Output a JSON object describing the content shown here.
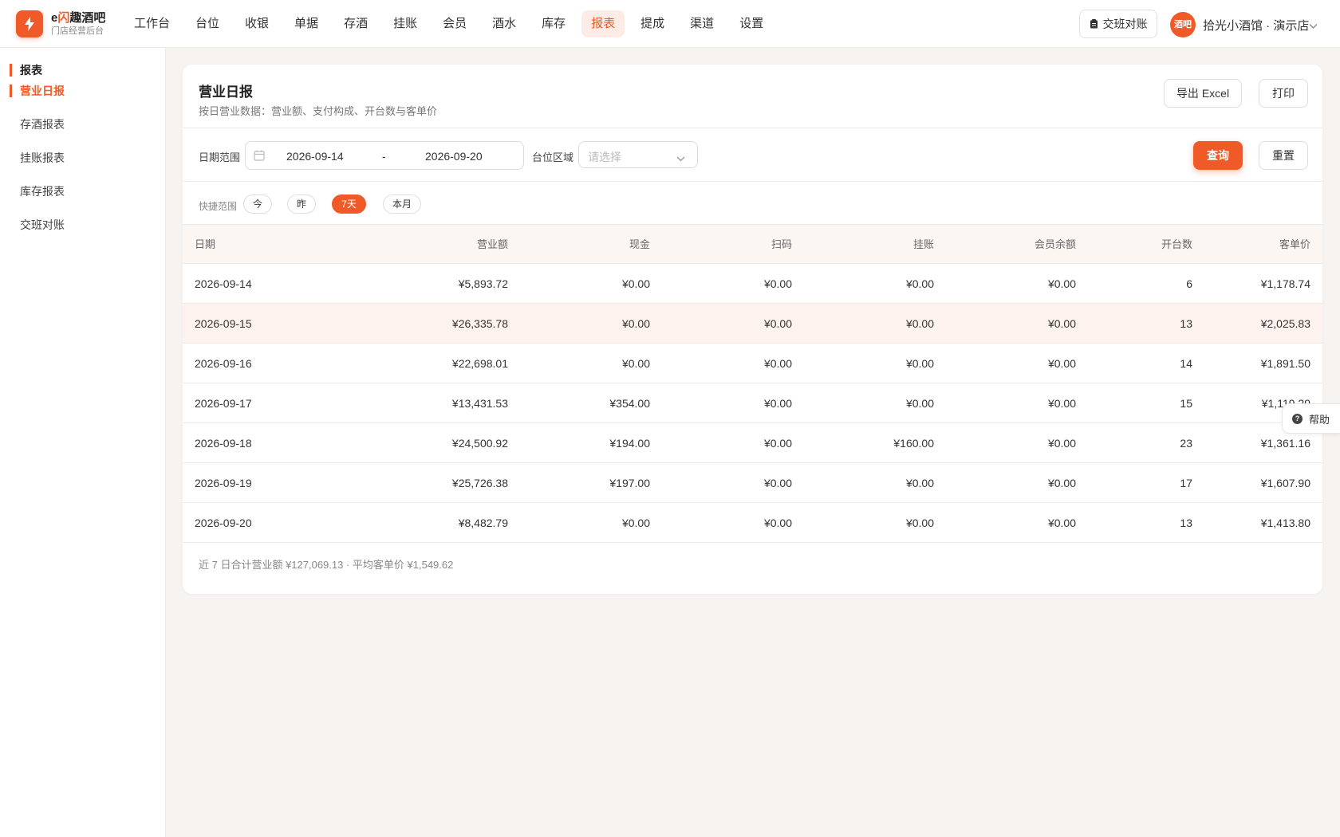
{
  "brand": {
    "name_prefix": "e",
    "name_highlight": "闪",
    "name_suffix": "趣酒吧",
    "subtitle": "门店经营后台",
    "accent": "#f05a28"
  },
  "nav": {
    "items": [
      "工作台",
      "台位",
      "收银",
      "单据",
      "存酒",
      "挂账",
      "会员",
      "酒水",
      "库存",
      "报表",
      "提成",
      "渠道",
      "设置"
    ],
    "active": "报表"
  },
  "header": {
    "shift_button": "交班对账",
    "store_avatar": "酒吧",
    "store_name": "拾光小酒馆 · 演示店"
  },
  "sidebar": {
    "section": "报表",
    "items": [
      "营业日报",
      "存酒报表",
      "挂账报表",
      "库存报表",
      "交班对账"
    ],
    "active": "营业日报"
  },
  "report": {
    "title": "营业日报",
    "subtitle": "按日营业数据：营业额、支付构成、开台数与客单价",
    "export_button": "导出 Excel",
    "print_button": "打印"
  },
  "filters": {
    "date_label": "日期范围",
    "date_start": "2026-09-14",
    "date_sep": "-",
    "date_end": "2026-09-20",
    "area_label": "台位区域",
    "area_placeholder": "请选择",
    "query_button": "查询",
    "reset_button": "重置",
    "quick_label": "快捷范围",
    "quick_options": [
      "今",
      "昨",
      "7天",
      "本月"
    ],
    "quick_active": "7天"
  },
  "table": {
    "columns": [
      "日期",
      "营业额",
      "现金",
      "扫码",
      "挂账",
      "会员余额",
      "开台数",
      "客单价"
    ],
    "rows": [
      [
        "2026-09-14",
        "¥5,893.72",
        "¥0.00",
        "¥0.00",
        "¥0.00",
        "¥0.00",
        "6",
        "¥1,178.74"
      ],
      [
        "2026-09-15",
        "¥26,335.78",
        "¥0.00",
        "¥0.00",
        "¥0.00",
        "¥0.00",
        "13",
        "¥2,025.83"
      ],
      [
        "2026-09-16",
        "¥22,698.01",
        "¥0.00",
        "¥0.00",
        "¥0.00",
        "¥0.00",
        "14",
        "¥1,891.50"
      ],
      [
        "2026-09-17",
        "¥13,431.53",
        "¥354.00",
        "¥0.00",
        "¥0.00",
        "¥0.00",
        "15",
        "¥1,119.29"
      ],
      [
        "2026-09-18",
        "¥24,500.92",
        "¥194.00",
        "¥0.00",
        "¥160.00",
        "¥0.00",
        "23",
        "¥1,361.16"
      ],
      [
        "2026-09-19",
        "¥25,726.38",
        "¥197.00",
        "¥0.00",
        "¥0.00",
        "¥0.00",
        "17",
        "¥1,607.90"
      ],
      [
        "2026-09-20",
        "¥8,482.79",
        "¥0.00",
        "¥0.00",
        "¥0.00",
        "¥0.00",
        "13",
        "¥1,413.80"
      ]
    ],
    "highlighted_row": 1,
    "summary": "近 7 日合计营业额 ¥127,069.13 · 平均客单价 ¥1,549.62"
  },
  "help": {
    "label": "帮助"
  }
}
